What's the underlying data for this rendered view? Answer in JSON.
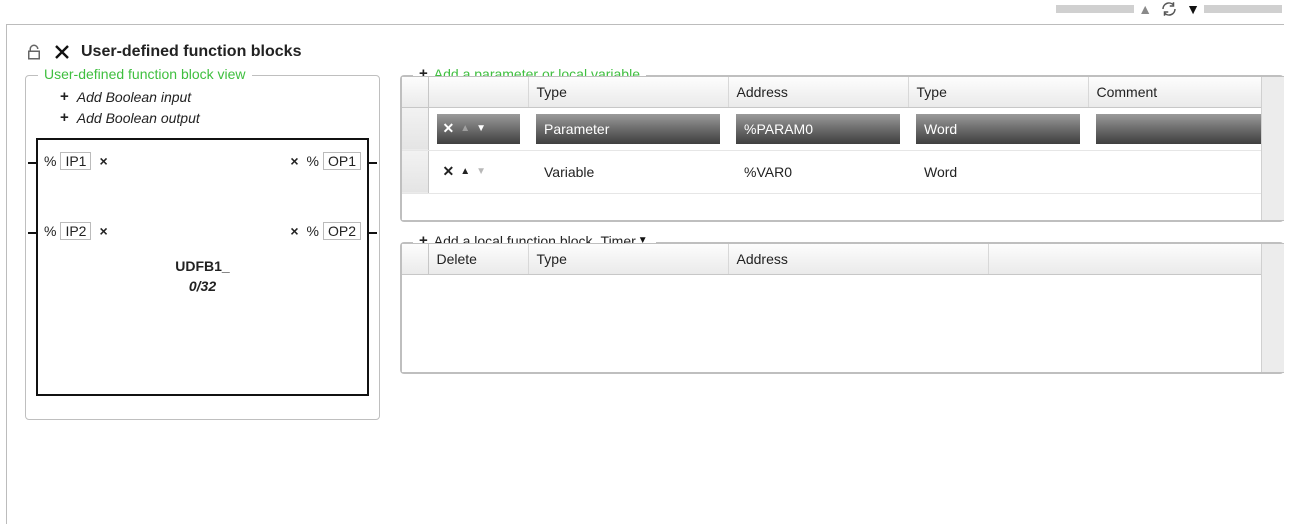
{
  "toolbar": {},
  "header": {
    "title": "User-defined function blocks"
  },
  "left": {
    "legend": "User-defined function block view",
    "add_bool_in": "Add Boolean input",
    "add_bool_out": "Add Boolean output",
    "block": {
      "name": "UDFB1_",
      "count": "0/32",
      "inputs": [
        {
          "pct": "%",
          "name": "IP1"
        },
        {
          "pct": "%",
          "name": "IP2"
        }
      ],
      "outputs": [
        {
          "pct": "%",
          "name": "OP1"
        },
        {
          "pct": "%",
          "name": "OP2"
        }
      ]
    }
  },
  "params": {
    "legend": "Add a parameter or local variable",
    "headers": {
      "type": "Type",
      "address": "Address",
      "type2": "Type",
      "comment": "Comment"
    },
    "rows": [
      {
        "type": "Parameter",
        "address": "%PARAM0",
        "type2": "Word",
        "comment": ""
      },
      {
        "type": "Variable",
        "address": "%VAR0",
        "type2": "Word",
        "comment": ""
      }
    ]
  },
  "localfb": {
    "legend": "Add a local function block",
    "dropdown": "Timer",
    "headers": {
      "delete": "Delete",
      "type": "Type",
      "address": "Address"
    }
  }
}
